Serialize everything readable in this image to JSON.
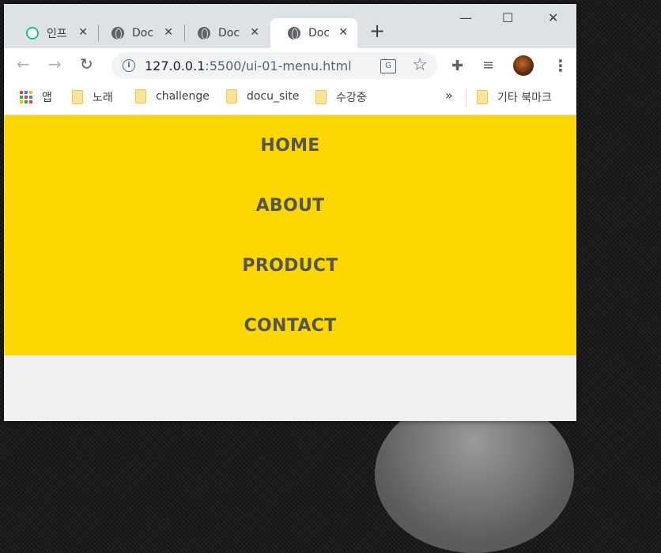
{
  "tabs": [
    {
      "label": "인프",
      "close": "✕",
      "icon": "inflearn-icon"
    },
    {
      "label": "Docu",
      "close": "✕",
      "icon": "globe-icon"
    },
    {
      "label": "Docu",
      "close": "✕",
      "icon": "globe-icon"
    },
    {
      "label": "Docu",
      "close": "✕",
      "icon": "globe-icon",
      "active": true
    }
  ],
  "new_tab": "+",
  "window_controls": {
    "minimize": "—",
    "maximize": "☐",
    "close": "✕"
  },
  "toolbar": {
    "back": "←",
    "forward": "→",
    "reload": "↻",
    "url_host": "127.0.0.1",
    "url_path": ":5500/ui-01-menu.html",
    "info": "i",
    "translate": "G",
    "star": "☆",
    "extensions": "✚",
    "media": "≡",
    "menu": "⋮"
  },
  "bookmarks": {
    "apps": "앱",
    "items": [
      "노래",
      "challenge",
      "docu_site",
      "수강중"
    ],
    "more": "»",
    "other": "기타 북마크"
  },
  "menu": {
    "items": [
      "HOME",
      "ABOUT",
      "PRODUCT",
      "CONTACT"
    ],
    "background": "#ffd700",
    "text_color": "#555555"
  }
}
